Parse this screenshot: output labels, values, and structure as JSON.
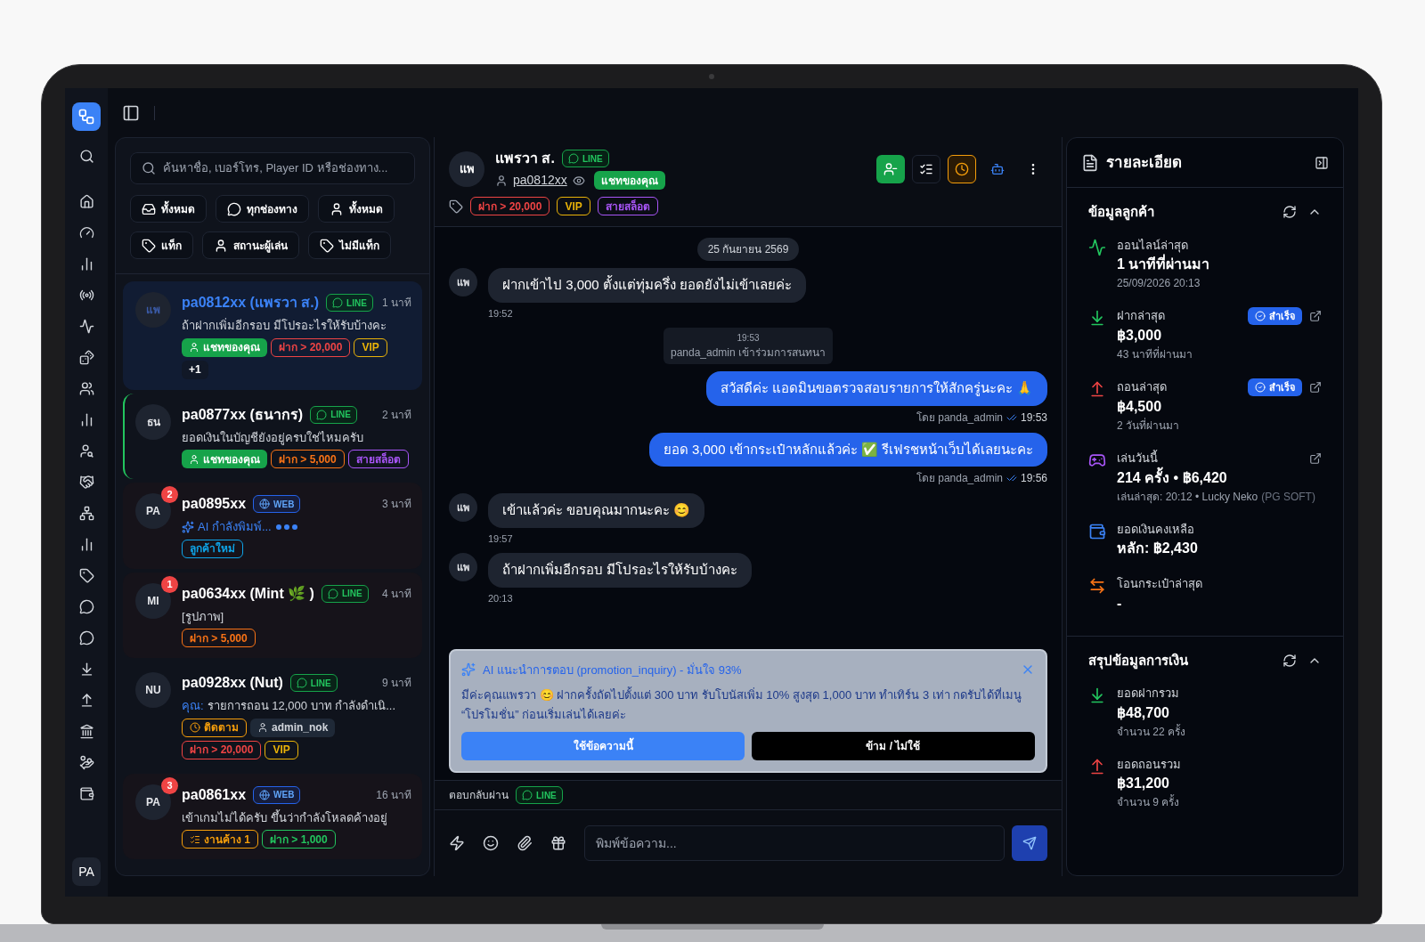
{
  "sidebar": {
    "user_initials": "PA"
  },
  "conversation_list": {
    "search": {
      "placeholder": "ค้นหาชื่อ, เบอร์โทร, Player ID หรือช่องทาง..."
    },
    "filters": [
      {
        "kind": "inbox",
        "label": "ทั้งหมด"
      },
      {
        "kind": "channel",
        "label": "ทุกช่องทาง"
      },
      {
        "kind": "user",
        "label": "ทั้งหมด"
      },
      {
        "kind": "tag",
        "label": "แท็ก"
      },
      {
        "kind": "user",
        "label": "สถานะผู้เล่น"
      },
      {
        "kind": "tag",
        "label": "ไม่มีแท็ก"
      }
    ],
    "conversations": [
      {
        "initials": "แพ",
        "name": "pa0812xx (แพรวา ส.)",
        "channel": {
          "kind": "line",
          "label": "LINE"
        },
        "time": "1 นาที",
        "preview": {
          "kind": "text",
          "text": "ถ้าฝากเพิ่มอีกรอบ มีโปรอะไรให้รับบ้างคะ"
        },
        "tags": [
          {
            "kind": "assigned",
            "label": "แชทของคุณ"
          },
          {
            "kind": "outline",
            "label": "ฝาก > 20,000",
            "color": "#ef4444"
          },
          {
            "kind": "outline",
            "label": "VIP",
            "color": "#eab308"
          },
          {
            "kind": "more",
            "label": "+1"
          }
        ],
        "selected": true,
        "highlighted": false
      },
      {
        "initials": "ธน",
        "name": "pa0877xx (ธนากร)",
        "channel": {
          "kind": "line",
          "label": "LINE"
        },
        "time": "2 นาที",
        "preview": {
          "kind": "text",
          "text": "ยอดเงินในบัญชียังอยู่ครบใช่ไหมครับ"
        },
        "tags": [
          {
            "kind": "assigned",
            "label": "แชทของคุณ"
          },
          {
            "kind": "outline",
            "label": "ฝาก > 5,000",
            "color": "#f97316"
          },
          {
            "kind": "outline",
            "label": "สายสล็อต",
            "color": "#a855f7"
          }
        ],
        "selected": false,
        "highlighted": true
      },
      {
        "initials": "PA",
        "unread": "2",
        "name": "pa0895xx",
        "channel": {
          "kind": "web",
          "label": "WEB"
        },
        "time": "3 นาที",
        "preview": {
          "kind": "typing",
          "text": "AI กำลังพิมพ์..."
        },
        "tags": [
          {
            "kind": "outline",
            "label": "ลูกค้าใหม่",
            "color": "#0ea5e9"
          }
        ],
        "selected": false,
        "highlighted": false
      },
      {
        "initials": "MI",
        "unread": "1",
        "name": "pa0634xx (Mint 🌿 )",
        "channel": {
          "kind": "line",
          "label": "LINE"
        },
        "time": "4 นาที",
        "preview": {
          "kind": "text",
          "text": "[รูปภาพ]"
        },
        "tags": [
          {
            "kind": "outline",
            "label": "ฝาก > 5,000",
            "color": "#f97316"
          }
        ],
        "selected": false,
        "highlighted": false
      },
      {
        "initials": "NU",
        "name": "pa0928xx (Nut)",
        "channel": {
          "kind": "line",
          "label": "LINE"
        },
        "time": "9 นาที",
        "preview": {
          "kind": "text",
          "prefix": "คุณ:",
          "text": "รายการถอน 12,000 บาท กำลังดำเนิ..."
        },
        "tags": [
          {
            "kind": "follow",
            "label": "ติดตาม",
            "color": "#f59e0b"
          },
          {
            "kind": "admin",
            "label": "admin_nok"
          },
          {
            "kind": "outline",
            "label": "ฝาก > 20,000",
            "color": "#ef4444"
          },
          {
            "kind": "outline",
            "label": "VIP",
            "color": "#eab308"
          }
        ],
        "selected": false,
        "highlighted": false
      },
      {
        "initials": "PA",
        "unread": "3",
        "name": "pa0861xx",
        "channel": {
          "kind": "web",
          "label": "WEB"
        },
        "time": "16 นาที",
        "preview": {
          "kind": "text",
          "text": "เข้าเกมไม่ได้ครับ ขึ้นว่ากำลังโหลดค้างอยู่"
        },
        "tags": [
          {
            "kind": "pending",
            "label": "งานค้าง 1",
            "color": "#f59e0b"
          },
          {
            "kind": "outline",
            "label": "ฝาก > 1,000",
            "color": "#22c55e"
          }
        ],
        "selected": false,
        "highlighted": false
      }
    ]
  },
  "chat": {
    "header": {
      "initials": "แพ",
      "name": "แพรวา ส.",
      "channel": {
        "kind": "line",
        "label": "LINE"
      },
      "username": "pa0812xx",
      "assigned_label": "แชทของคุณ",
      "tags": [
        {
          "label": "ฝาก > 20,000",
          "color": "#ef4444"
        },
        {
          "label": "VIP",
          "color": "#eab308"
        },
        {
          "label": "สายสล็อต",
          "color": "#a855f7"
        }
      ]
    },
    "messages": [
      {
        "kind": "date",
        "text": "25 กันยายน 2569"
      },
      {
        "kind": "incoming",
        "initials": "แพ",
        "text": "ฝากเข้าไป 3,000 ตั้งแต่ทุ่มครึ่ง ยอดยังไม่เข้าเลยค่ะ",
        "time": "19:52"
      },
      {
        "kind": "system",
        "time": "19:53",
        "text": "panda_admin เข้าร่วมการสนทนา"
      },
      {
        "kind": "outgoing",
        "text": "สวัสดีค่ะ แอดมินขอตรวจสอบรายการให้สักครู่นะคะ 🙏",
        "by": "โดย panda_admin",
        "time": "19:53"
      },
      {
        "kind": "outgoing",
        "text": "ยอด 3,000 เข้ากระเป๋าหลักแล้วค่ะ ✅ รีเฟรชหน้าเว็บได้เลยนะคะ",
        "by": "โดย panda_admin",
        "time": "19:56"
      },
      {
        "kind": "incoming",
        "initials": "แพ",
        "text": "เข้าแล้วค่ะ ขอบคุณมากนะคะ 😊",
        "time": "19:57"
      },
      {
        "kind": "incoming",
        "initials": "แพ",
        "text": "ถ้าฝากเพิ่มอีกรอบ มีโปรอะไรให้รับบ้างคะ",
        "time": "20:13"
      }
    ],
    "suggestion": {
      "title": "AI แนะนำการตอบ (promotion_inquiry) - มั่นใจ 93%",
      "text": "มีค่ะคุณแพรวา 😊  ฝากครั้งถัดไปตั้งแต่ 300 บาท รับโบนัสเพิ่ม 10% สูงสุด 1,000 บาท ทำเทิร์น 3 เท่า กดรับได้ที่เมนู “โปรโมชั่น” ก่อนเริ่มเล่นได้เลยค่ะ",
      "buttons": [
        {
          "kind": "primary",
          "label": "ใช้ข้อความนี้"
        },
        {
          "kind": "secondary",
          "label": "ข้าม / ไม่ใช้"
        }
      ]
    },
    "reply_via": {
      "label": "ตอบกลับผ่าน",
      "channel": {
        "kind": "line",
        "label": "LINE"
      }
    },
    "composer": {
      "placeholder": "พิมพ์ข้อความ..."
    }
  },
  "details": {
    "title": "รายละเอียด",
    "sections": [
      {
        "title": "ข้อมูลลูกค้า",
        "expanded": true,
        "items": [
          {
            "kind": "online",
            "label": "ออนไลน์ล่าสุด",
            "value": "1 นาทีที่ผ่านมา",
            "sub": "25/09/2026 20:13"
          },
          {
            "kind": "deposit",
            "label": "ฝากล่าสุด",
            "value": "฿3,000",
            "sub": "43 นาทีที่ผ่านมา",
            "status": "สำเร็จ",
            "link": true
          },
          {
            "kind": "withdraw",
            "label": "ถอนล่าสุด",
            "value": "฿4,500",
            "sub": "2 วันที่ผ่านมา",
            "status": "สำเร็จ",
            "link": true
          },
          {
            "kind": "play",
            "label": "เล่นวันนี้",
            "value": "214 ครั้ง • ฿6,420",
            "sub": "เล่นล่าสุด: 20:12 • Lucky Neko",
            "sub_note": "(PG SOFT)",
            "link": true
          },
          {
            "kind": "balance",
            "label": "ยอดเงินคงเหลือ",
            "value": "หลัก: ฿2,430"
          },
          {
            "kind": "transfer",
            "label": "โอนกระเป๋าล่าสุด",
            "value": "-"
          }
        ]
      },
      {
        "title": "สรุปข้อมูลการเงิน",
        "expanded": true,
        "items": [
          {
            "kind": "deposit",
            "label": "ยอดฝากรวม",
            "value": "฿48,700",
            "sub": "จำนวน 22 ครั้ง"
          },
          {
            "kind": "withdraw",
            "label": "ยอดถอนรวม",
            "value": "฿31,200",
            "sub": "จำนวน 9 ครั้ง"
          }
        ]
      }
    ]
  }
}
